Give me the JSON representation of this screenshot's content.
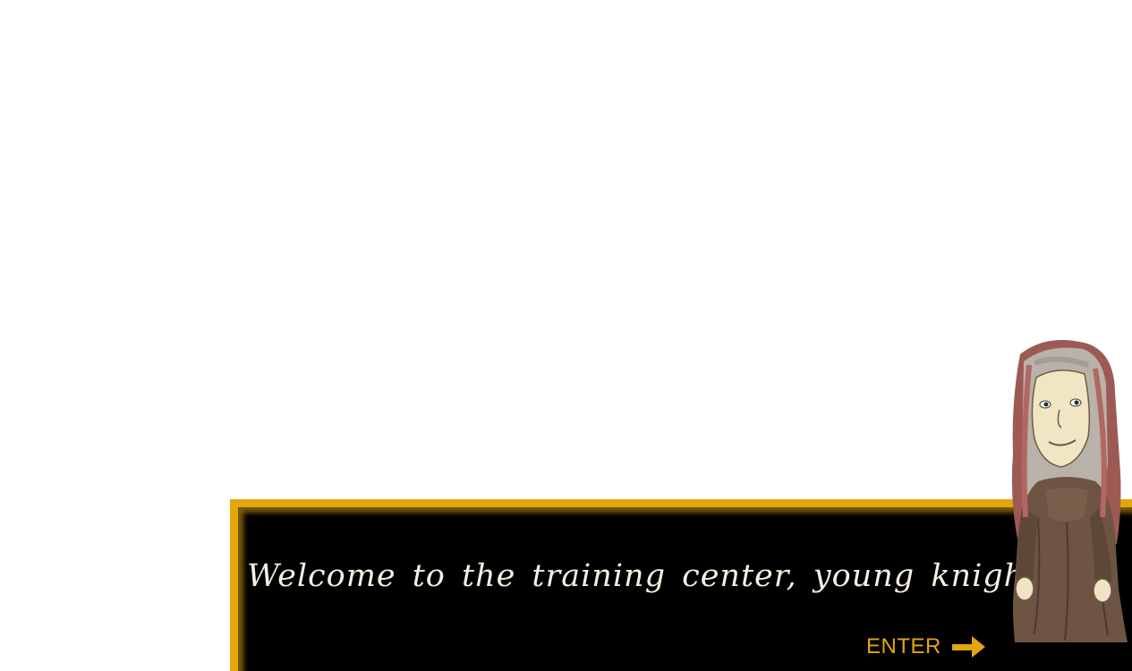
{
  "dialog": {
    "message": "Welcome to the training center, young knight.",
    "enter_label": "ENTER"
  },
  "icons": {
    "enter_arrow": "arrow-right-icon",
    "character": "mentor-character"
  },
  "colors": {
    "accent_gold": "#e2a60f",
    "panel_bg": "#000000",
    "text": "#f4efe2"
  }
}
